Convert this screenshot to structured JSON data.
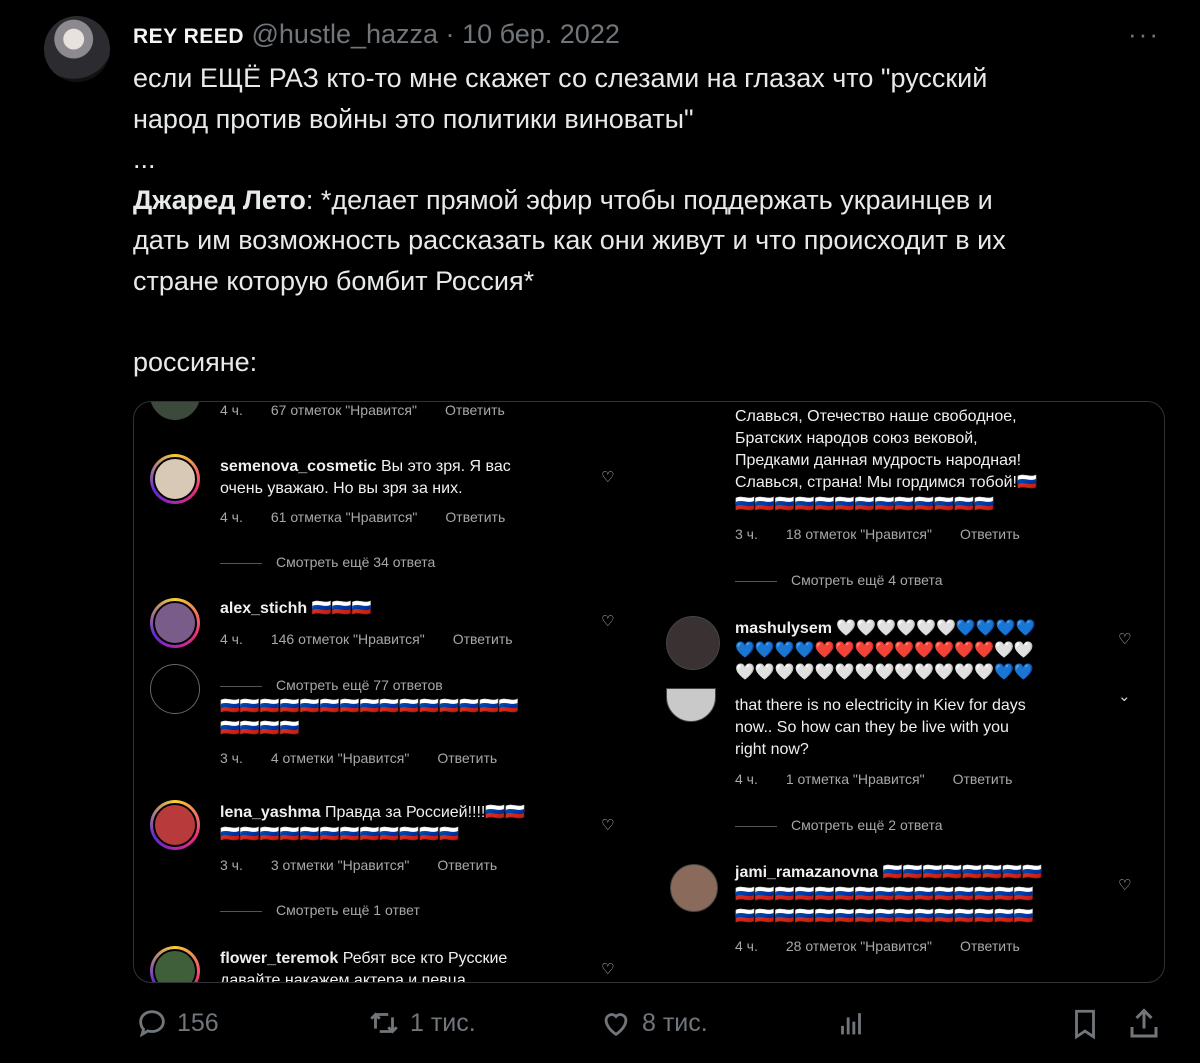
{
  "tweet": {
    "author_name": "REY REED",
    "handle": "@hustle_hazza",
    "separator": "·",
    "date": "10 бер. 2022",
    "more": "···",
    "lines": {
      "l1": "если ЕЩЁ РАЗ кто-то мне скажет со слезами на глазах что \"русский",
      "l2": "народ против войны это политики виноваты\"",
      "l3": "...",
      "l4_bold": "Джаред Лето",
      "l4_rest": ": *делает прямой эфир чтобы поддержать украинцев и",
      "l5": "дать им возможность рассказать как они живут и что происходит в их",
      "l6": "стране которую бомбит Россия*",
      "l7": "россияне:"
    }
  },
  "screenshot": {
    "left": {
      "top_meta": {
        "time": "4 ч.",
        "likes": "67 отметок \"Нравится\"",
        "reply": "Ответить"
      },
      "c1": {
        "user": "semenova_cosmetic",
        "text": "Вы это зря. Я вас",
        "text2": "очень уважаю. Но вы зря за них.",
        "time": "4 ч.",
        "likes": "61 отметка \"Нравится\"",
        "reply": "Ответить"
      },
      "more1": "Смотреть ещё 34 ответа",
      "c2": {
        "user": "alex_stichh",
        "flags": "🇷🇺🇷🇺🇷🇺",
        "time": "4 ч.",
        "likes": "146 отметок \"Нравится\"",
        "reply": "Ответить"
      },
      "more2": "Смотреть ещё 77 ответов",
      "c3": {
        "flags1": "🇷🇺🇷🇺🇷🇺🇷🇺🇷🇺🇷🇺🇷🇺🇷🇺🇷🇺🇷🇺🇷🇺🇷🇺🇷🇺🇷🇺🇷🇺",
        "flags2": "🇷🇺🇷🇺🇷🇺🇷🇺",
        "time": "3 ч.",
        "likes": "4 отметки \"Нравится\"",
        "reply": "Ответить"
      },
      "c4": {
        "user": "lena_yashma",
        "text": "Правда за Россией!!!!",
        "flags1": "🇷🇺🇷🇺",
        "flags2": "🇷🇺🇷🇺🇷🇺🇷🇺🇷🇺🇷🇺🇷🇺🇷🇺🇷🇺🇷🇺🇷🇺🇷🇺",
        "time": "3 ч.",
        "likes": "3 отметки \"Нравится\"",
        "reply": "Ответить"
      },
      "more3": "Смотреть ещё 1 ответ",
      "c5": {
        "user": "flower_teremok",
        "text": "Ребят все кто Русские",
        "text2": "давайте накажем актера и певца"
      }
    },
    "right": {
      "anthem": [
        "Славься, Отечество наше свободное,",
        "Братских народов союз вековой,",
        "Предками данная мудрость народная!",
        "Славься, страна! Мы гордимся тобой!🇷🇺"
      ],
      "anthem_flags": "🇷🇺🇷🇺🇷🇺🇷🇺🇷🇺🇷🇺🇷🇺🇷🇺🇷🇺🇷🇺🇷🇺🇷🇺🇷🇺",
      "anthem_meta": {
        "time": "3 ч.",
        "likes": "18 отметок \"Нравится\"",
        "reply": "Ответить"
      },
      "more1": "Смотреть ещё 4 ответа",
      "c1": {
        "user": "mashulysem",
        "hearts1": "🤍🤍🤍🤍🤍🤍💙💙💙💙",
        "hearts2": "💙💙💙💙❤️❤️❤️❤️❤️❤️❤️❤️❤️🤍🤍",
        "hearts3": "🤍🤍🤍🤍🤍🤍🤍🤍🤍🤍🤍🤍🤍💙💙"
      },
      "c2": {
        "text1": "that there is no electricity in Kiev for days",
        "text2": "now.. So how can they be live with you",
        "text3": "right now?",
        "time": "4 ч.",
        "likes": "1 отметка \"Нравится\"",
        "reply": "Ответить"
      },
      "more2": "Смотреть ещё 2 ответа",
      "c3": {
        "user": "jami_ramazanovna",
        "flags1": "🇷🇺🇷🇺🇷🇺🇷🇺🇷🇺🇷🇺🇷🇺🇷🇺",
        "flags2": "🇷🇺🇷🇺🇷🇺🇷🇺🇷🇺🇷🇺🇷🇺🇷🇺🇷🇺🇷🇺🇷🇺🇷🇺🇷🇺🇷🇺🇷🇺",
        "flags3": "🇷🇺🇷🇺🇷🇺🇷🇺🇷🇺🇷🇺🇷🇺🇷🇺🇷🇺🇷🇺🇷🇺🇷🇺🇷🇺🇷🇺🇷🇺",
        "time": "4 ч.",
        "likes": "28 отметок \"Нравится\"",
        "reply": "Ответить"
      }
    }
  },
  "actions": {
    "replies": "156",
    "retweets": "1 тис.",
    "likes": "8 тис."
  },
  "icons": [
    "reply-icon",
    "retweet-icon",
    "like-icon",
    "views-icon",
    "bookmark-icon",
    "share-icon",
    "heart-icon"
  ]
}
